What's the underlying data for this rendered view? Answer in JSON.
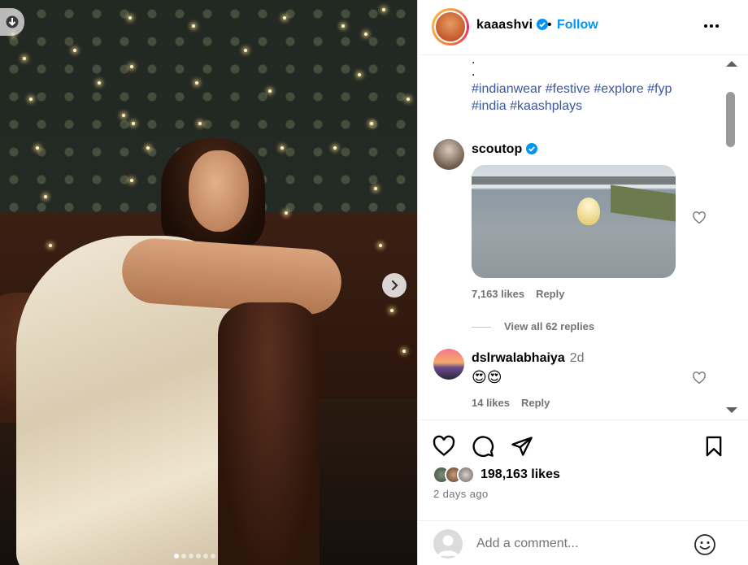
{
  "post": {
    "photo_alt": "",
    "carousel": {
      "total": 6,
      "active_index": 0
    }
  },
  "header": {
    "username": "kaaashvi",
    "separator": "•",
    "follow_label": "Follow"
  },
  "caption": {
    "dot_lines": [
      ".",
      "."
    ],
    "line1": "#indianwear #festive #explore #fyp",
    "line2": "#india #kaashplays"
  },
  "comments": [
    {
      "username": "scoutop",
      "verified": true,
      "time": "",
      "text": "",
      "likes": "7,163 likes",
      "reply_label": "Reply",
      "view_replies": "View all 62 replies"
    },
    {
      "username": "dslrwalabhaiya",
      "verified": false,
      "time": "2d",
      "text": "😍😍",
      "likes": "14 likes",
      "reply_label": "Reply"
    }
  ],
  "footer": {
    "likes_count": "198,163 likes",
    "posted_ago": "2 days ago",
    "add_comment_placeholder": "Add a comment..."
  },
  "colors": {
    "accent": "#0095f6",
    "hashtag": "#3a56a6",
    "muted": "#737373",
    "verified": "#0095f6"
  },
  "icons": {
    "download": "arrow-down-icon",
    "next": "chevron-right-icon",
    "more": "more-horizontal-icon",
    "like": "heart-icon",
    "comment": "comment-bubble-icon",
    "share": "paper-plane-icon",
    "save": "bookmark-icon",
    "emoji": "smiley-icon"
  }
}
